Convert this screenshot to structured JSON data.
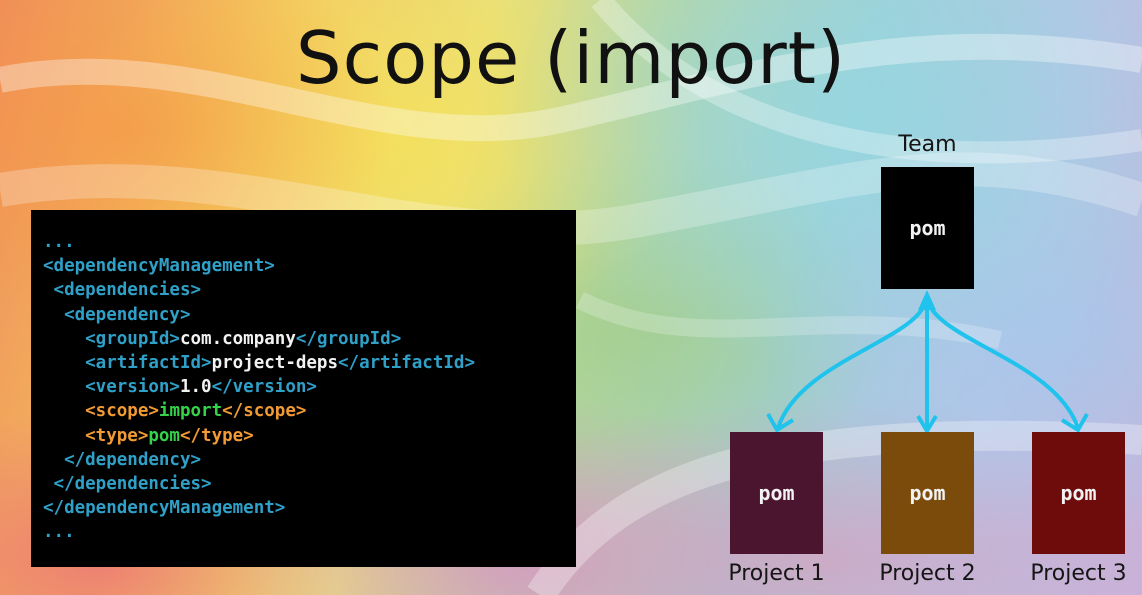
{
  "slide": {
    "title": "Scope (import)"
  },
  "code": {
    "lines": [
      {
        "pre": "...",
        "txt": "",
        "post": "",
        "style": "plain"
      },
      {
        "pre": "<dependencyManagement>",
        "txt": "",
        "post": "",
        "style": "plain"
      },
      {
        "pre": " <dependencies>",
        "txt": "",
        "post": "",
        "style": "plain"
      },
      {
        "pre": "  <dependency>",
        "txt": "",
        "post": "",
        "style": "plain"
      },
      {
        "pre": "    <groupId>",
        "txt": "com.company",
        "post": "</groupId>",
        "style": "plain"
      },
      {
        "pre": "    <artifactId>",
        "txt": "project-deps",
        "post": "</artifactId>",
        "style": "plain"
      },
      {
        "pre": "    <version>",
        "txt": "1.0",
        "post": "</version>",
        "style": "plain"
      },
      {
        "pre": "    <scope>",
        "txt": "import",
        "post": "</scope>",
        "style": "highlight"
      },
      {
        "pre": "    <type>",
        "txt": "pom",
        "post": "</type>",
        "style": "highlight"
      },
      {
        "pre": "  </dependency>",
        "txt": "",
        "post": "",
        "style": "plain"
      },
      {
        "pre": " </dependencies>",
        "txt": "",
        "post": "",
        "style": "plain"
      },
      {
        "pre": "</dependencyManagement>",
        "txt": "",
        "post": "",
        "style": "plain"
      },
      {
        "pre": "...",
        "txt": "",
        "post": "",
        "style": "plain"
      }
    ]
  },
  "diagram": {
    "team": {
      "label": "Team",
      "box_text": "pom",
      "color": "#000000"
    },
    "projects": [
      {
        "label": "Project 1",
        "box_text": "pom",
        "color": "#4b1530"
      },
      {
        "label": "Project 2",
        "box_text": "pom",
        "color": "#7a4b0b"
      },
      {
        "label": "Project 3",
        "box_text": "pom",
        "color": "#6e0b0b"
      }
    ],
    "arrow_color": "#1fc3ec"
  },
  "colors": {
    "code_tag": "#2fa0c8",
    "code_text": "#f2f2f2",
    "code_highlight_tag": "#f29a33",
    "code_highlight_value": "#34d34a"
  }
}
